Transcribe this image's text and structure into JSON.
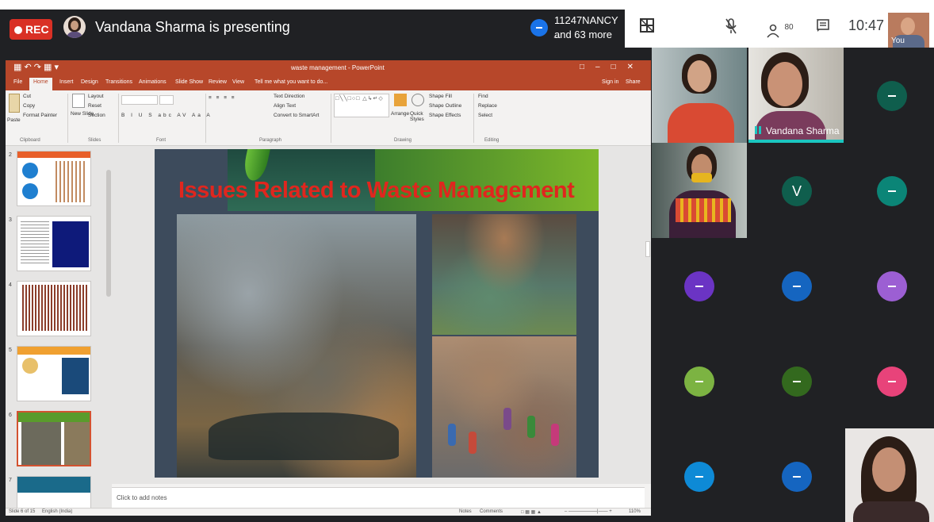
{
  "meet": {
    "rec_label": "REC",
    "presenting_text": "Vandana Sharma is presenting",
    "participants_line1": "11247NANCY _",
    "participants_line2": "and 63 more",
    "people_count": "80",
    "clock": "10:47",
    "self_label": "You",
    "speaker_name": "Vandana Sharma",
    "avatar_letter": "V",
    "colors": {
      "red": "#d93025",
      "teal": "#0b8577",
      "purple": "#6b34c4",
      "blue": "#1565c0",
      "lightgreen": "#7cb342",
      "darkgreen": "#33691e",
      "violet": "#9c5fd3",
      "pink": "#e8437a",
      "cyan": "#0e8ad6",
      "deepteal": "#0f5e4d"
    }
  },
  "ppt": {
    "window_title": "waste management - PowerPoint",
    "tabs": [
      "File",
      "Home",
      "Insert",
      "Design",
      "Transitions",
      "Animations",
      "Slide Show",
      "Review",
      "View",
      "Tell me what you want to do..."
    ],
    "signin": "Sign in",
    "share": "Share",
    "ribbon": {
      "paste": "Paste",
      "cut": "Cut",
      "copy": "Copy",
      "format_painter": "Format Painter",
      "new_slide": "New Slide",
      "layout": "Layout",
      "reset": "Reset",
      "section": "Section",
      "text_direction": "Text Direction",
      "align_text": "Align Text",
      "smartart": "Convert to SmartArt",
      "arrange": "Arrange",
      "quick_styles": "Quick Styles",
      "shape_fill": "Shape Fill",
      "shape_outline": "Shape Outline",
      "shape_effects": "Shape Effects",
      "find": "Find",
      "replace": "Replace",
      "select": "Select",
      "groups": [
        "Clipboard",
        "Slides",
        "Font",
        "Paragraph",
        "Drawing",
        "Editing"
      ]
    },
    "thumb_numbers": [
      "2",
      "3",
      "4",
      "5",
      "6",
      "7"
    ],
    "slide_title": "Issues Related to Waste Management",
    "notes_placeholder": "Click to add notes",
    "status_slide": "Slide 6 of 15",
    "status_lang": "English (India)",
    "notes_btn": "Notes",
    "comments_btn": "Comments",
    "zoom": "110%"
  }
}
